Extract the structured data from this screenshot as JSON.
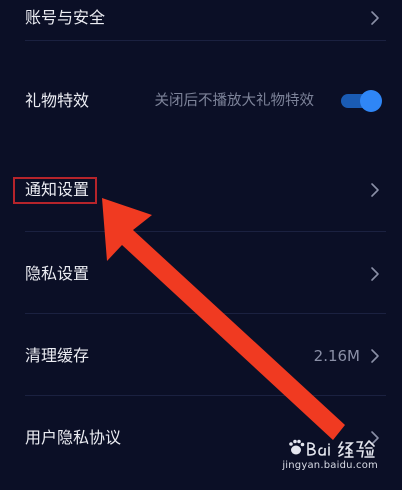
{
  "settings": {
    "account_security": {
      "label": "账号与安全"
    },
    "gift_effects": {
      "label": "礼物特效",
      "hint": "关闭后不播放大礼物特效",
      "toggle_on": true
    },
    "notifications": {
      "label": "通知设置"
    },
    "privacy": {
      "label": "隐私设置"
    },
    "clear_cache": {
      "label": "清理缓存",
      "value": "2.16M"
    },
    "privacy_policy": {
      "label": "用户隐私协议"
    }
  },
  "annotation": {
    "highlight_color": "#b6242b",
    "arrow_color": "#f03a21"
  },
  "watermark": {
    "brand": "Baidu 经验",
    "url": "jingyan.baidu.com"
  },
  "icons": {
    "chevron": "chevron-right-icon"
  },
  "colors": {
    "background": "#0b0f26",
    "toggle_accent": "#2f86f6"
  }
}
